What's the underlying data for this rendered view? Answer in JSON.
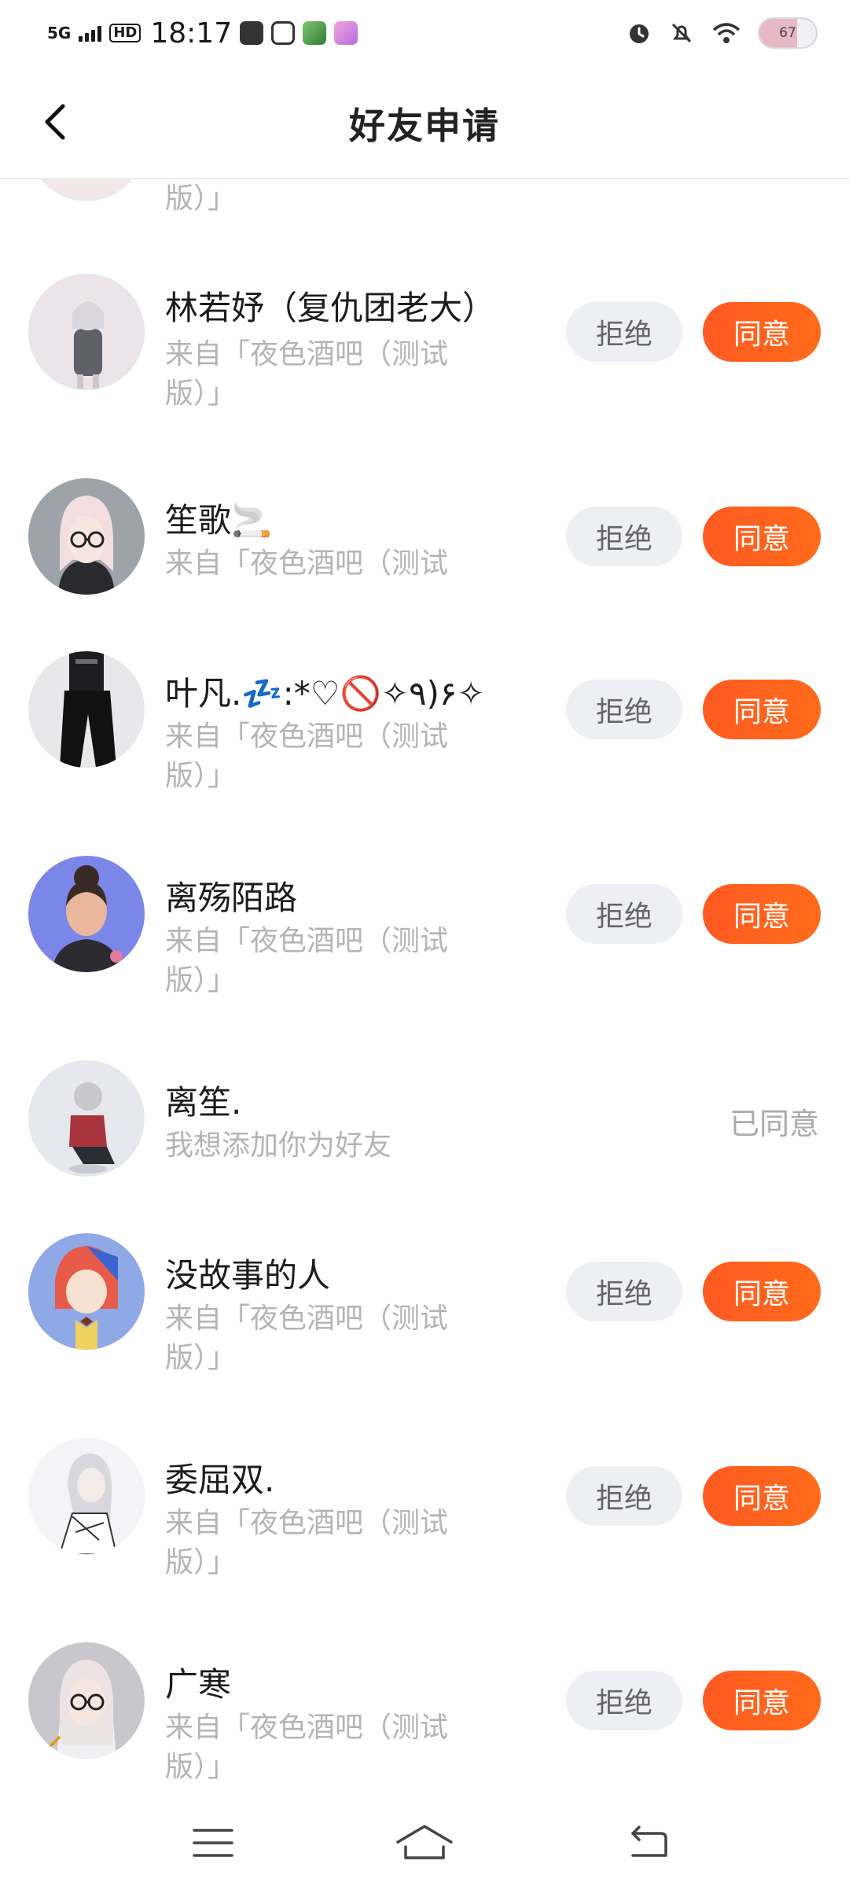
{
  "status_bar": {
    "network": "5G",
    "hd": "HD",
    "time": "18:17",
    "battery": "67",
    "battery_level": 0.67,
    "icons": [
      "mail-icon",
      "app-icon",
      "app-icon",
      "app-icon",
      "alarm-icon",
      "mute-icon",
      "wifi-icon"
    ]
  },
  "header": {
    "title": "好友申请",
    "back_icon": "chevron-left-icon"
  },
  "partial_row": {
    "source_tail": "版）」"
  },
  "requests": [
    {
      "nick": "林若妤（复仇团老大）",
      "source": "来自「夜色酒吧（测试版）」",
      "status": "pending"
    },
    {
      "nick": "笙歌🚬",
      "source": "来自「夜色酒吧（测试",
      "status": "pending"
    },
    {
      "nick": "叶凡.💤:*♡🚫✧٩)۶✧",
      "source": "来自「夜色酒吧（测试版）」",
      "status": "pending"
    },
    {
      "nick": "离殇陌路",
      "source": "来自「夜色酒吧（测试版）」",
      "status": "pending"
    },
    {
      "nick": "离笙.",
      "source": "我想添加你为好友",
      "status": "agreed"
    },
    {
      "nick": "没故事的人",
      "source": "来自「夜色酒吧（测试版）」",
      "status": "pending"
    },
    {
      "nick": "委屈双.",
      "source": "来自「夜色酒吧（测试版）」",
      "status": "pending"
    },
    {
      "nick": "广寒",
      "source": "来自「夜色酒吧（测试版）」",
      "status": "pending"
    }
  ],
  "labels": {
    "reject": "拒绝",
    "agree": "同意",
    "agreed": "已同意"
  },
  "colors": {
    "accent": "#ff5a22",
    "reject_bg": "#eeeff3",
    "secondary_text": "#b4b4b4"
  },
  "nav": {
    "icons": [
      "menu-icon",
      "home-icon",
      "back-icon"
    ]
  }
}
